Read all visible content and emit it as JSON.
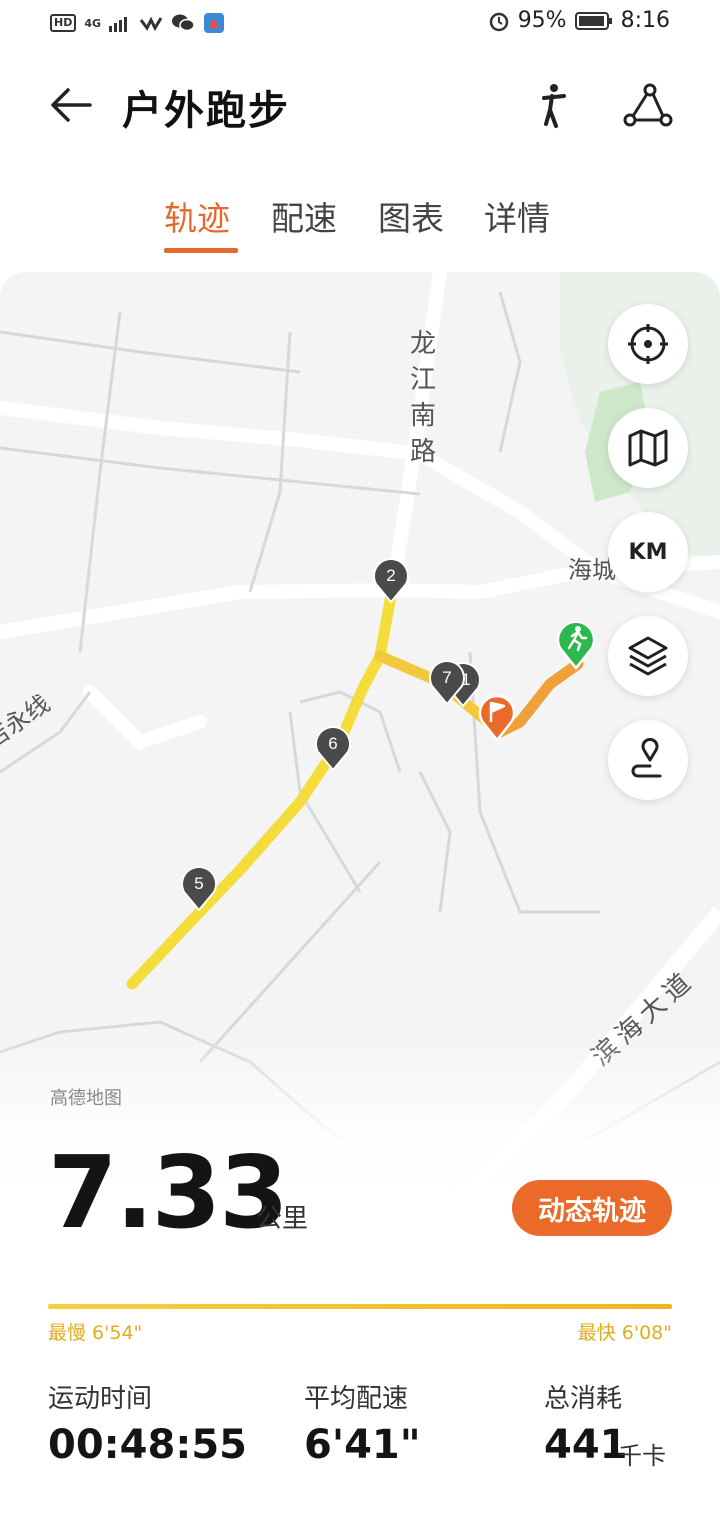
{
  "status_bar": {
    "hd": "HD",
    "network": "4G",
    "battery": "95%",
    "time": "8:16"
  },
  "header": {
    "title": "户外跑步",
    "icons": [
      "back-arrow-icon",
      "runner-pose-icon",
      "route-share-icon"
    ]
  },
  "tabs": [
    {
      "label": "轨迹",
      "active": true
    },
    {
      "label": "配速",
      "active": false
    },
    {
      "label": "图表",
      "active": false
    },
    {
      "label": "详情",
      "active": false
    }
  ],
  "map": {
    "road_labels": {
      "longjiang": [
        "龙",
        "江",
        "南",
        "路"
      ],
      "haicheng": "海城",
      "yongxian": "吉永线",
      "binhai": "滨海大道"
    },
    "km_markers": [
      "2",
      "7",
      "6",
      "5",
      "1"
    ],
    "controls": {
      "locate": "crosshair-icon",
      "map": "map-icon",
      "km": "KM",
      "layers": "layers-icon",
      "route_pin": "route-pin-icon"
    },
    "provider": "高德地图",
    "start_color": "#2db84d",
    "end_color": "#ec6a29"
  },
  "summary": {
    "distance": "7.33",
    "distance_unit": "公里",
    "dynamic_track_button": "动态轨迹",
    "slowest": "最慢 6'54\"",
    "fastest": "最快 6'08\""
  },
  "stats": [
    {
      "label": "运动时间",
      "value": "00:48:55",
      "unit": ""
    },
    {
      "label": "平均配速",
      "value": "6'41\"",
      "unit": ""
    },
    {
      "label": "总消耗",
      "value": "441",
      "unit": "千卡"
    }
  ],
  "colors": {
    "accent": "#e46a2b",
    "track_slow": "#f4dc3a",
    "track_fast": "#f0a03a",
    "pace_label": "#e0ad1f"
  }
}
